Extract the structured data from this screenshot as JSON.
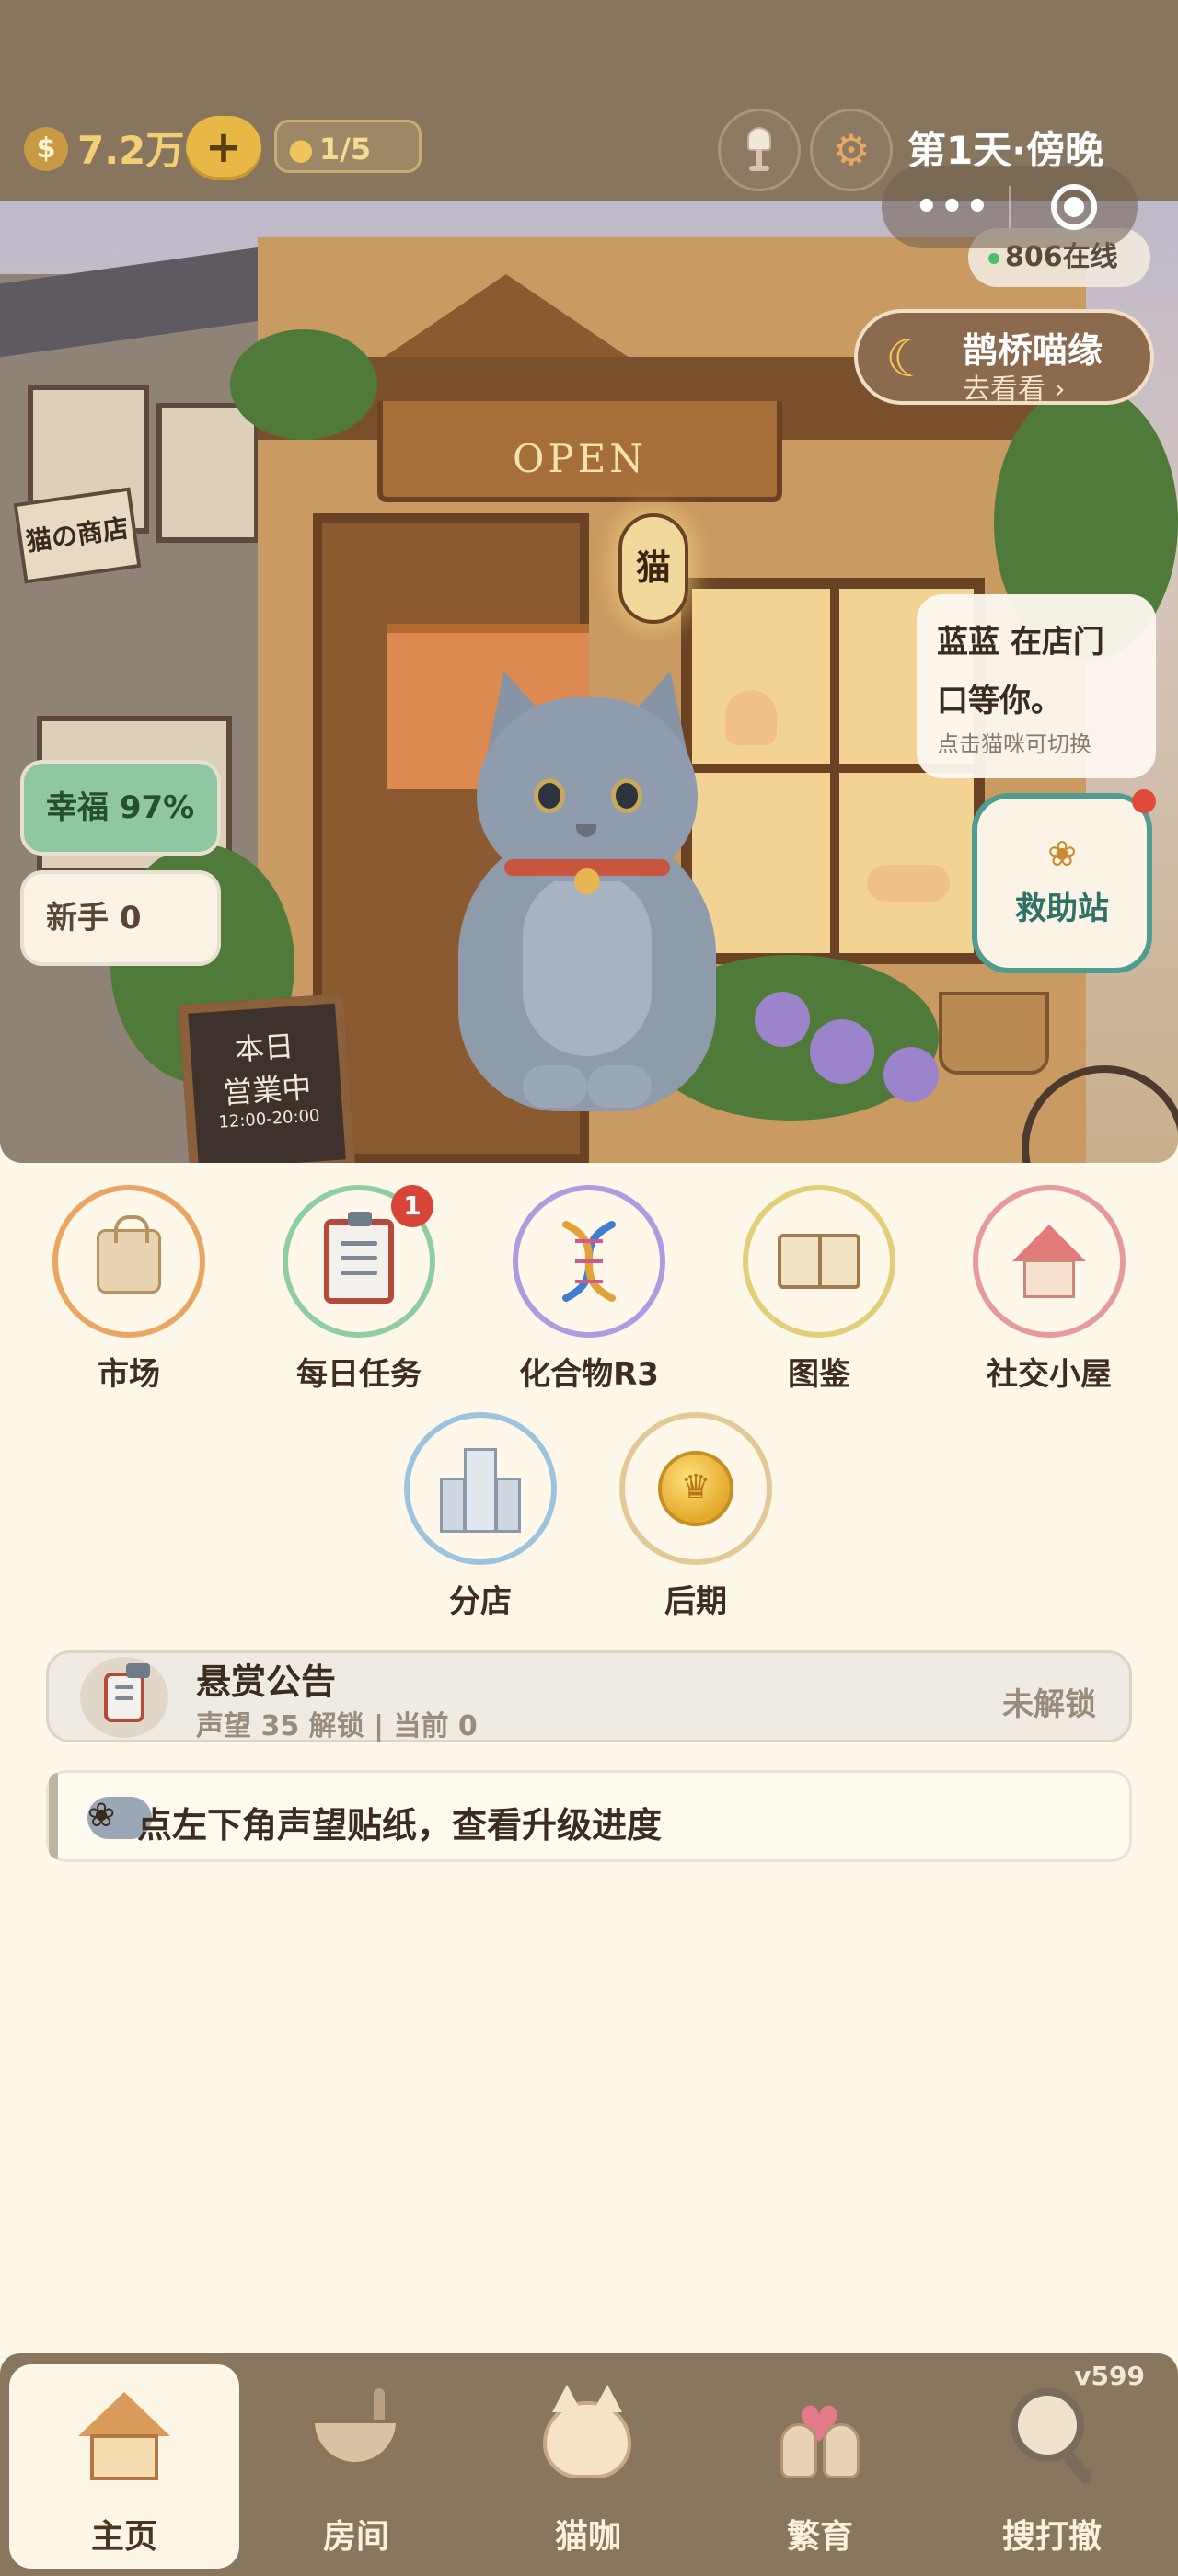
{
  "topbar": {
    "coin_icon": "money-bag-icon",
    "money": "7.2万",
    "add_label": "+",
    "cat_count": "1/5",
    "day_label": "第1天·傍晚"
  },
  "scene": {
    "online": "806在线",
    "event": {
      "title": "鹊桥喵缘",
      "subtitle": "去看看 ›"
    },
    "speech": {
      "line1": "蓝蓝 在店门",
      "line2": "口等你。",
      "hint": "点击猫咪可切换"
    },
    "rescue_label": "救助站",
    "happiness": "幸福 97%",
    "rookie": "新手 0",
    "shop_sign": "OPEN",
    "lantern": "猫",
    "left_sign": "猫の商店",
    "board": {
      "line1": "本日",
      "line2": "営業中",
      "line3": "12:00-20:00"
    }
  },
  "features": [
    {
      "label": "市场",
      "icon": "shopping-bag-icon",
      "color": "#eaa563"
    },
    {
      "label": "每日任务",
      "icon": "clipboard-icon",
      "color": "#8fcf9f",
      "badge": "1"
    },
    {
      "label": "化合物R3",
      "icon": "dna-icon",
      "color": "#b39ae0"
    },
    {
      "label": "图鉴",
      "icon": "book-icon",
      "color": "#e3cf7a"
    },
    {
      "label": "社交小屋",
      "icon": "house-icon",
      "color": "#e79a9a"
    },
    {
      "label": "分店",
      "icon": "building-icon",
      "color": "#9dc4de"
    },
    {
      "label": "后期",
      "icon": "crown-coin-icon",
      "color": "#e3c995"
    }
  ],
  "bounty": {
    "title": "悬赏公告",
    "subtitle": "声望 35 解锁 | 当前 0",
    "status": "未解锁"
  },
  "tip": {
    "icon": "paw-icon",
    "text": "点左下角声望贴纸，查看升级进度"
  },
  "nav": {
    "version": "v599",
    "tabs": [
      {
        "label": "主页",
        "icon": "home-icon",
        "active": true
      },
      {
        "label": "房间",
        "icon": "bowl-icon",
        "active": false
      },
      {
        "label": "猫咖",
        "icon": "cat-cup-icon",
        "active": false
      },
      {
        "label": "繁育",
        "icon": "cats-heart-icon",
        "active": false
      },
      {
        "label": "搜打撤",
        "icon": "magnifier-map-icon",
        "active": false
      }
    ]
  }
}
